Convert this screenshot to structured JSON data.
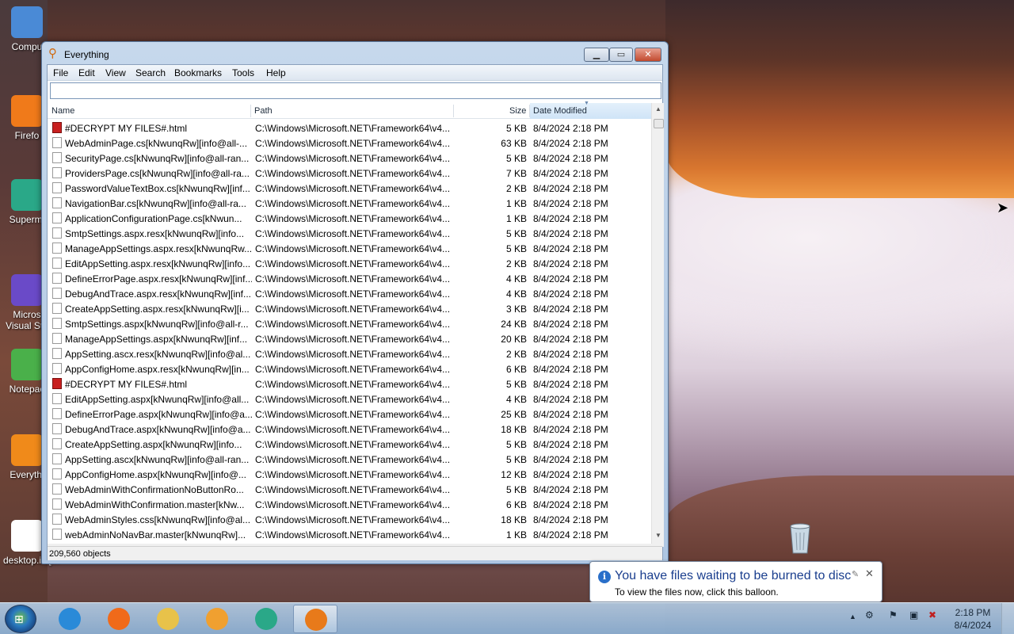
{
  "desktop": {
    "icons": [
      {
        "label": "Compu",
        "glyph_color": "#4a8ad6"
      },
      {
        "label": "Firefo",
        "glyph_color": "#f07a1a"
      },
      {
        "label": "Supermi",
        "glyph_color": "#2aa888"
      },
      {
        "label": "Micros Visual Stu",
        "glyph_color": "#6a4ac8"
      },
      {
        "label": "Notepac",
        "glyph_color": "#4ab04a"
      },
      {
        "label": "Everythi",
        "glyph_color": "#f08a1a"
      },
      {
        "label": "desktop.ini[...",
        "glyph_color": "#ffffff"
      }
    ]
  },
  "window": {
    "title": "Everything",
    "menu": [
      "File",
      "Edit",
      "View",
      "Search",
      "Bookmarks",
      "Tools",
      "Help"
    ],
    "search_value": "",
    "columns": {
      "name": "Name",
      "path": "Path",
      "size": "Size",
      "date": "Date Modified"
    },
    "rows": [
      {
        "icon": "html",
        "name": "#DECRYPT MY FILES#.html",
        "path": "C:\\Windows\\Microsoft.NET\\Framework64\\v4...",
        "size": "5 KB",
        "date": "8/4/2024 2:18 PM"
      },
      {
        "icon": "file",
        "name": "WebAdminPage.cs[kNwunqRw][info@all-...",
        "path": "C:\\Windows\\Microsoft.NET\\Framework64\\v4...",
        "size": "63 KB",
        "date": "8/4/2024 2:18 PM"
      },
      {
        "icon": "file",
        "name": "SecurityPage.cs[kNwunqRw][info@all-ran...",
        "path": "C:\\Windows\\Microsoft.NET\\Framework64\\v4...",
        "size": "5 KB",
        "date": "8/4/2024 2:18 PM"
      },
      {
        "icon": "file",
        "name": "ProvidersPage.cs[kNwunqRw][info@all-ra...",
        "path": "C:\\Windows\\Microsoft.NET\\Framework64\\v4...",
        "size": "7 KB",
        "date": "8/4/2024 2:18 PM"
      },
      {
        "icon": "file",
        "name": "PasswordValueTextBox.cs[kNwunqRw][inf...",
        "path": "C:\\Windows\\Microsoft.NET\\Framework64\\v4...",
        "size": "2 KB",
        "date": "8/4/2024 2:18 PM"
      },
      {
        "icon": "file",
        "name": "NavigationBar.cs[kNwunqRw][info@all-ra...",
        "path": "C:\\Windows\\Microsoft.NET\\Framework64\\v4...",
        "size": "1 KB",
        "date": "8/4/2024 2:18 PM"
      },
      {
        "icon": "file",
        "name": "ApplicationConfigurationPage.cs[kNwun...",
        "path": "C:\\Windows\\Microsoft.NET\\Framework64\\v4...",
        "size": "1 KB",
        "date": "8/4/2024 2:18 PM"
      },
      {
        "icon": "file",
        "name": "SmtpSettings.aspx.resx[kNwunqRw][info...",
        "path": "C:\\Windows\\Microsoft.NET\\Framework64\\v4...",
        "size": "5 KB",
        "date": "8/4/2024 2:18 PM"
      },
      {
        "icon": "file",
        "name": "ManageAppSettings.aspx.resx[kNwunqRw...",
        "path": "C:\\Windows\\Microsoft.NET\\Framework64\\v4...",
        "size": "5 KB",
        "date": "8/4/2024 2:18 PM"
      },
      {
        "icon": "file",
        "name": "EditAppSetting.aspx.resx[kNwunqRw][info...",
        "path": "C:\\Windows\\Microsoft.NET\\Framework64\\v4...",
        "size": "2 KB",
        "date": "8/4/2024 2:18 PM"
      },
      {
        "icon": "file",
        "name": "DefineErrorPage.aspx.resx[kNwunqRw][inf...",
        "path": "C:\\Windows\\Microsoft.NET\\Framework64\\v4...",
        "size": "4 KB",
        "date": "8/4/2024 2:18 PM"
      },
      {
        "icon": "file",
        "name": "DebugAndTrace.aspx.resx[kNwunqRw][inf...",
        "path": "C:\\Windows\\Microsoft.NET\\Framework64\\v4...",
        "size": "4 KB",
        "date": "8/4/2024 2:18 PM"
      },
      {
        "icon": "file",
        "name": "CreateAppSetting.aspx.resx[kNwunqRw][i...",
        "path": "C:\\Windows\\Microsoft.NET\\Framework64\\v4...",
        "size": "3 KB",
        "date": "8/4/2024 2:18 PM"
      },
      {
        "icon": "file",
        "name": "SmtpSettings.aspx[kNwunqRw][info@all-r...",
        "path": "C:\\Windows\\Microsoft.NET\\Framework64\\v4...",
        "size": "24 KB",
        "date": "8/4/2024 2:18 PM"
      },
      {
        "icon": "file",
        "name": "ManageAppSettings.aspx[kNwunqRw][inf...",
        "path": "C:\\Windows\\Microsoft.NET\\Framework64\\v4...",
        "size": "20 KB",
        "date": "8/4/2024 2:18 PM"
      },
      {
        "icon": "file",
        "name": "AppSetting.ascx.resx[kNwunqRw][info@al...",
        "path": "C:\\Windows\\Microsoft.NET\\Framework64\\v4...",
        "size": "2 KB",
        "date": "8/4/2024 2:18 PM"
      },
      {
        "icon": "file",
        "name": "AppConfigHome.aspx.resx[kNwunqRw][in...",
        "path": "C:\\Windows\\Microsoft.NET\\Framework64\\v4...",
        "size": "6 KB",
        "date": "8/4/2024 2:18 PM"
      },
      {
        "icon": "html",
        "name": "#DECRYPT MY FILES#.html",
        "path": "C:\\Windows\\Microsoft.NET\\Framework64\\v4...",
        "size": "5 KB",
        "date": "8/4/2024 2:18 PM"
      },
      {
        "icon": "file",
        "name": "EditAppSetting.aspx[kNwunqRw][info@all...",
        "path": "C:\\Windows\\Microsoft.NET\\Framework64\\v4...",
        "size": "4 KB",
        "date": "8/4/2024 2:18 PM"
      },
      {
        "icon": "file",
        "name": "DefineErrorPage.aspx[kNwunqRw][info@a...",
        "path": "C:\\Windows\\Microsoft.NET\\Framework64\\v4...",
        "size": "25 KB",
        "date": "8/4/2024 2:18 PM"
      },
      {
        "icon": "file",
        "name": "DebugAndTrace.aspx[kNwunqRw][info@a...",
        "path": "C:\\Windows\\Microsoft.NET\\Framework64\\v4...",
        "size": "18 KB",
        "date": "8/4/2024 2:18 PM"
      },
      {
        "icon": "file",
        "name": "CreateAppSetting.aspx[kNwunqRw][info...",
        "path": "C:\\Windows\\Microsoft.NET\\Framework64\\v4...",
        "size": "5 KB",
        "date": "8/4/2024 2:18 PM"
      },
      {
        "icon": "file",
        "name": "AppSetting.ascx[kNwunqRw][info@all-ran...",
        "path": "C:\\Windows\\Microsoft.NET\\Framework64\\v4...",
        "size": "5 KB",
        "date": "8/4/2024 2:18 PM"
      },
      {
        "icon": "file",
        "name": "AppConfigHome.aspx[kNwunqRw][info@...",
        "path": "C:\\Windows\\Microsoft.NET\\Framework64\\v4...",
        "size": "12 KB",
        "date": "8/4/2024 2:18 PM"
      },
      {
        "icon": "file",
        "name": "WebAdminWithConfirmationNoButtonRo...",
        "path": "C:\\Windows\\Microsoft.NET\\Framework64\\v4...",
        "size": "5 KB",
        "date": "8/4/2024 2:18 PM"
      },
      {
        "icon": "file",
        "name": "WebAdminWithConfirmation.master[kNw...",
        "path": "C:\\Windows\\Microsoft.NET\\Framework64\\v4...",
        "size": "6 KB",
        "date": "8/4/2024 2:18 PM"
      },
      {
        "icon": "file",
        "name": "WebAdminStyles.css[kNwunqRw][info@al...",
        "path": "C:\\Windows\\Microsoft.NET\\Framework64\\v4...",
        "size": "18 KB",
        "date": "8/4/2024 2:18 PM"
      },
      {
        "icon": "file",
        "name": "webAdminNoNavBar.master[kNwunqRw]...",
        "path": "C:\\Windows\\Microsoft.NET\\Framework64\\v4...",
        "size": "1 KB",
        "date": "8/4/2024 2:18 PM"
      }
    ],
    "status": "209,560 objects"
  },
  "balloon": {
    "title": "You have files waiting to be burned to disc",
    "text": "To view the files now, click this balloon."
  },
  "taskbar": {
    "items": [
      {
        "name": "internet-explorer",
        "color": "#2a8ad8"
      },
      {
        "name": "firefox",
        "color": "#f06a1a"
      },
      {
        "name": "file-explorer",
        "color": "#e8c24a"
      },
      {
        "name": "media-player",
        "color": "#f0a030"
      },
      {
        "name": "superminer",
        "color": "#2aa888"
      },
      {
        "name": "everything",
        "color": "#e87a1a"
      }
    ],
    "clock": {
      "time": "2:18 PM",
      "date": "8/4/2024"
    }
  }
}
